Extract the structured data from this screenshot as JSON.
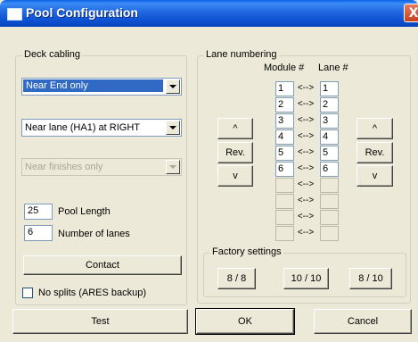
{
  "window": {
    "title": "Pool Configuration",
    "close": "X"
  },
  "deck": {
    "legend": "Deck cabling",
    "end_select": "Near End only",
    "lane_select": "Near lane (HA1) at RIGHT",
    "finish_select": "Near finishes only",
    "pool_length_value": "25",
    "pool_length_label": "Pool Length",
    "lanes_value": "6",
    "lanes_label": "Number of lanes",
    "contact_button": "Contact",
    "no_splits_label": "No splits (ARES backup)"
  },
  "lane_numbering": {
    "legend": "Lane numbering",
    "module_header": "Module #",
    "lane_header": "Lane #",
    "arrow": "<-->",
    "rows": [
      {
        "module": "1",
        "lane": "1"
      },
      {
        "module": "2",
        "lane": "2"
      },
      {
        "module": "3",
        "lane": "3"
      },
      {
        "module": "4",
        "lane": "4"
      },
      {
        "module": "5",
        "lane": "5"
      },
      {
        "module": "6",
        "lane": "6"
      },
      {
        "module": "",
        "lane": ""
      },
      {
        "module": "",
        "lane": ""
      },
      {
        "module": "",
        "lane": ""
      },
      {
        "module": "",
        "lane": ""
      }
    ],
    "left_up": "^",
    "left_rev": "Rev.",
    "left_down": "v",
    "right_up": "^",
    "right_rev": "Rev.",
    "right_down": "v"
  },
  "factory": {
    "legend": "Factory settings",
    "btn_8_8": "8 / 8",
    "btn_10_10": "10 / 10",
    "btn_8_10": "8 / 10"
  },
  "bottom": {
    "test": "Test",
    "ok": "OK",
    "cancel": "Cancel"
  }
}
